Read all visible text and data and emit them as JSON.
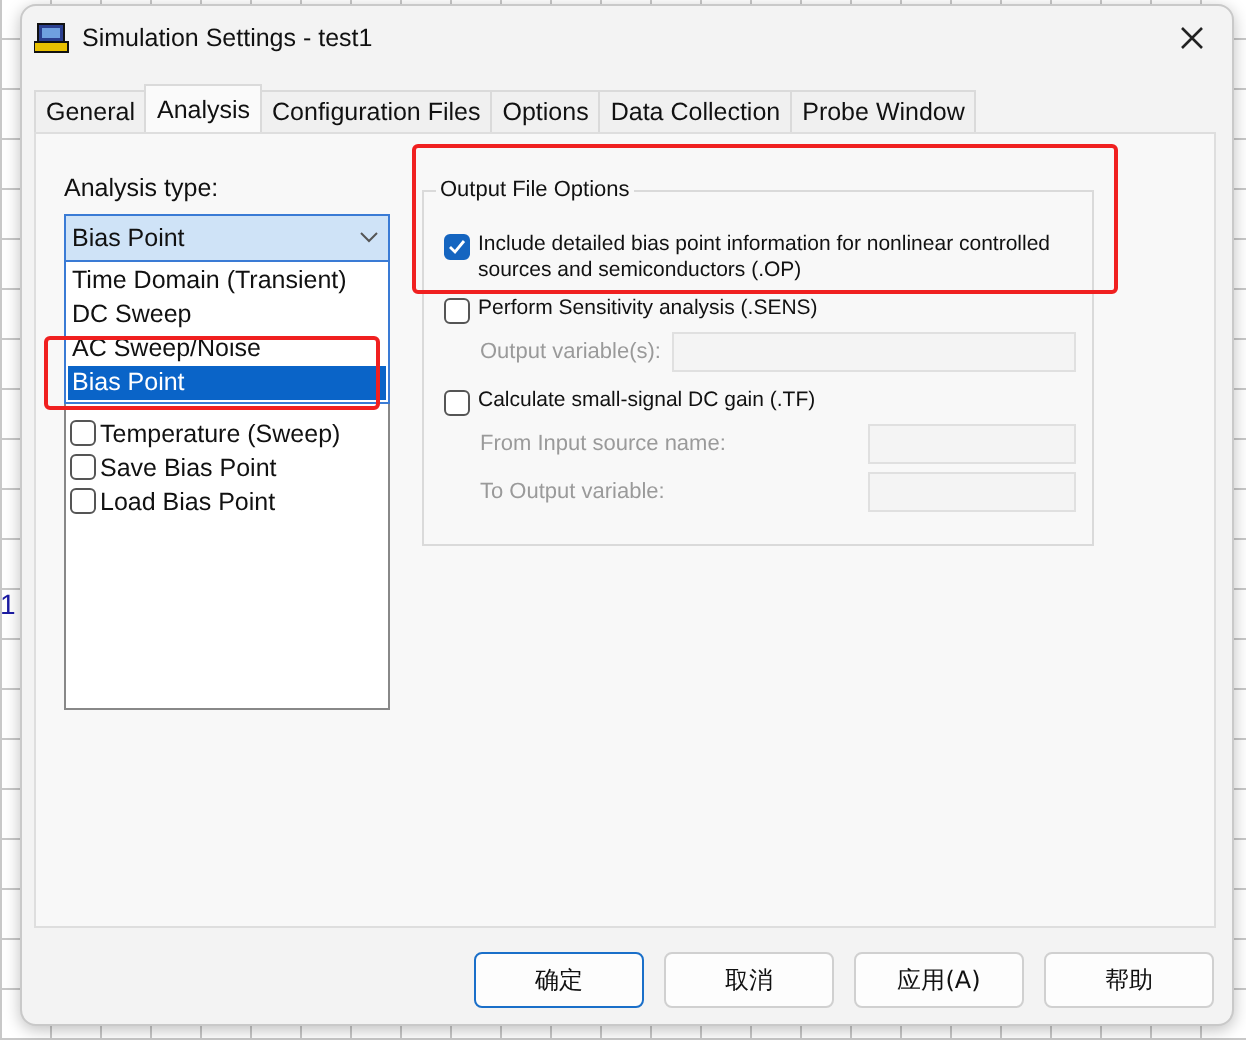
{
  "background": {
    "label": "1"
  },
  "window": {
    "title": "Simulation Settings - test1"
  },
  "tabs": [
    {
      "label": "General",
      "selected": false
    },
    {
      "label": "Analysis",
      "selected": true
    },
    {
      "label": "Configuration Files",
      "selected": false
    },
    {
      "label": "Options",
      "selected": false
    },
    {
      "label": "Data Collection",
      "selected": false
    },
    {
      "label": "Probe Window",
      "selected": false
    }
  ],
  "analysis_type": {
    "label": "Analysis type:",
    "value": "Bias Point",
    "dropdown_items": [
      {
        "label": "Time Domain (Transient)",
        "selected": false
      },
      {
        "label": "DC Sweep",
        "selected": false
      },
      {
        "label": "AC Sweep/Noise",
        "selected": false
      },
      {
        "label": "Bias Point",
        "selected": true
      }
    ]
  },
  "options_list": [
    {
      "label": "Temperature (Sweep)",
      "checked": false
    },
    {
      "label": "Save Bias Point",
      "checked": false
    },
    {
      "label": "Load Bias Point",
      "checked": false
    }
  ],
  "output_file_options": {
    "title": "Output File Options",
    "items": [
      {
        "label": "Include detailed bias point information for nonlinear controlled sources and semiconductors (.OP)",
        "checked": true
      },
      {
        "label": "Perform Sensitivity analysis (.SENS)",
        "checked": false,
        "children": [
          {
            "label": "Output variable(s):",
            "disabled": true
          }
        ]
      },
      {
        "label": "Calculate small-signal DC gain (.TF)",
        "checked": false,
        "children": [
          {
            "label": "From Input source name:",
            "disabled": true
          },
          {
            "label": "To Output variable:",
            "disabled": true
          }
        ]
      }
    ]
  },
  "buttons": [
    {
      "label": "确定",
      "default": true
    },
    {
      "label": "取消",
      "default": false
    },
    {
      "label": "应用(A)",
      "default": false
    },
    {
      "label": "帮助",
      "default": false
    }
  ]
}
